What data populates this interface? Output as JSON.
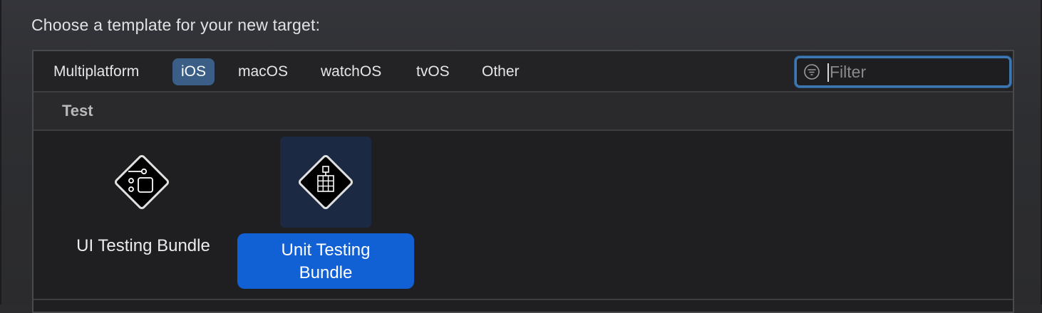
{
  "prompt": "Choose a template for your new target:",
  "platform_tabs": [
    {
      "label": "Multiplatform",
      "active": false
    },
    {
      "label": "iOS",
      "active": true
    },
    {
      "label": "macOS",
      "active": false
    },
    {
      "label": "watchOS",
      "active": false
    },
    {
      "label": "tvOS",
      "active": false
    },
    {
      "label": "Other",
      "active": false
    }
  ],
  "filter": {
    "placeholder": "Filter",
    "value": "",
    "icon": "filter-icon"
  },
  "section": {
    "title": "Test"
  },
  "templates": [
    {
      "label": "UI Testing Bundle",
      "icon": "ui-testing-bundle-icon",
      "selected": false
    },
    {
      "label_line1": "Unit Testing",
      "label_line2": "Bundle",
      "icon": "unit-testing-bundle-icon",
      "selected": true
    }
  ],
  "colors": {
    "accent": "#1160d4",
    "active_tab": "#3a5e86",
    "focus_ring": "#3d78b3"
  }
}
